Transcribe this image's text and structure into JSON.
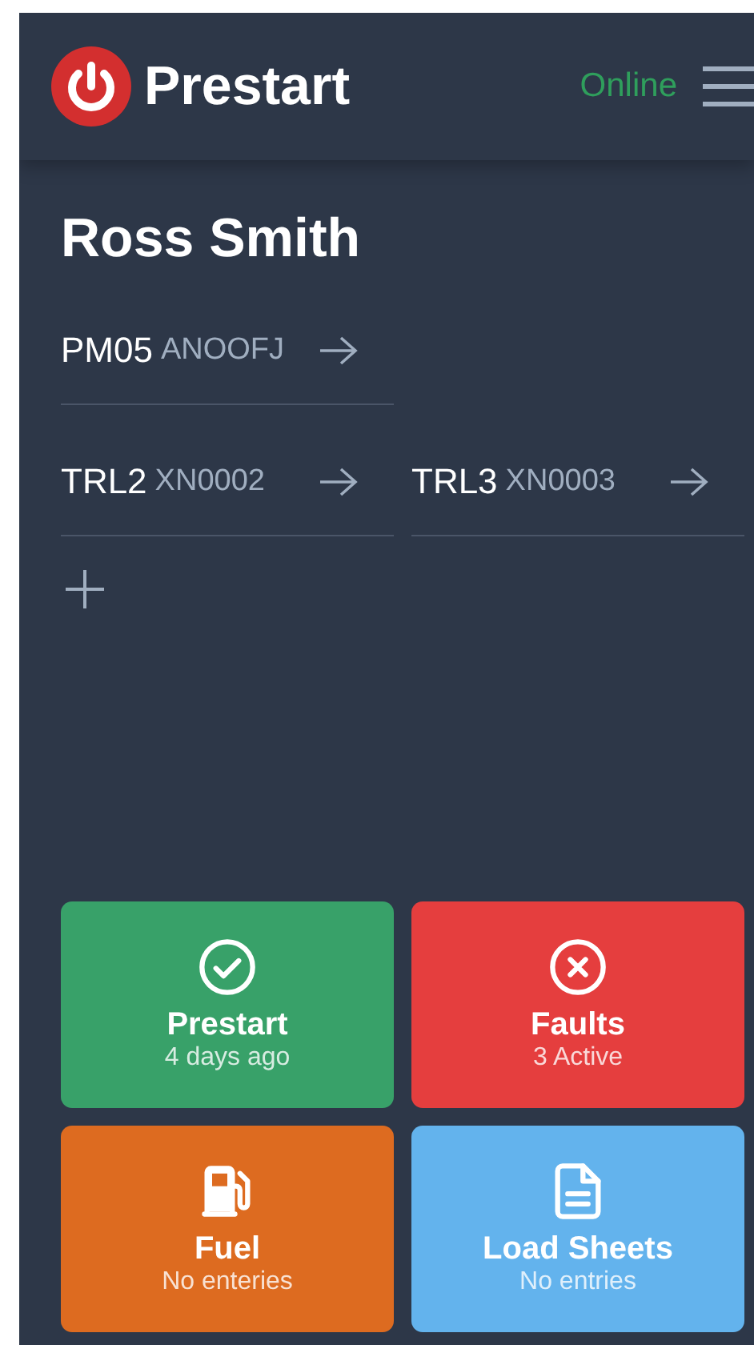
{
  "header": {
    "title": "Prestart",
    "status": "Online"
  },
  "driver": {
    "name": "Ross Smith"
  },
  "vehicle_rows": [
    {
      "vehicles": [
        {
          "code": "PM05",
          "rego": "ANOOFJ"
        }
      ]
    },
    {
      "vehicles": [
        {
          "code": "TRL2",
          "rego": "XN0002"
        },
        {
          "code": "TRL3",
          "rego": "XN0003"
        }
      ]
    }
  ],
  "tiles": [
    {
      "kind": "check",
      "title": "Prestart",
      "subtitle": "4 days ago",
      "color": "#38a169"
    },
    {
      "kind": "cross",
      "title": "Faults",
      "subtitle": "3 Active",
      "color": "#e53e3e"
    },
    {
      "kind": "fuel",
      "title": "Fuel",
      "subtitle": "No enteries",
      "color": "#dd6b20"
    },
    {
      "kind": "document",
      "title": "Load Sheets",
      "subtitle": "No entries",
      "color": "#63b3ed"
    }
  ]
}
